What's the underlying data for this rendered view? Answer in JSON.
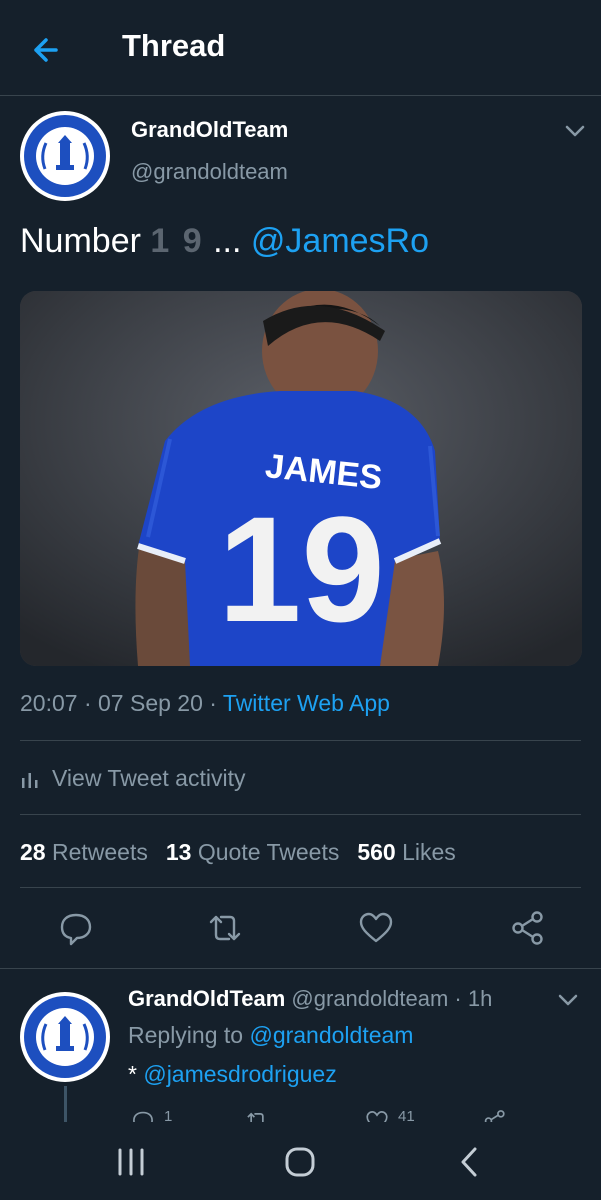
{
  "header": {
    "title": "Thread",
    "back_icon": "arrow-left-icon"
  },
  "tweet": {
    "author_name": "GrandOldTeam",
    "author_handle": "@grandoldteam",
    "avatar_ring_text": "It's a GrandOldTeam To Support",
    "avatar_badge": "GOT",
    "text_prefix": "Number",
    "text_numbers": "1  9",
    "text_ellipsis": " ... ",
    "text_mention": "@JamesRo",
    "image": {
      "jersey_name": "JAMES",
      "jersey_number": "19",
      "jersey_color": "#1d45c8"
    },
    "time": "20:07",
    "date": "07 Sep 20",
    "separator": " · ",
    "source": "Twitter Web App",
    "activity_label": "View Tweet activity",
    "stats": {
      "retweets_count": "28",
      "retweets_label": "Retweets",
      "quotes_count": "13",
      "quotes_label": "Quote Tweets",
      "likes_count": "560",
      "likes_label": "Likes"
    }
  },
  "reply": {
    "author_name": "GrandOldTeam",
    "author_handle": "@grandoldteam",
    "time_ago": "1h",
    "replying_prefix": "Replying to",
    "replying_handle": "@grandoldteam",
    "body_prefix": "*",
    "body_mention": "@jamesdrodriguez",
    "reply_count": "1",
    "like_count": "41"
  },
  "colors": {
    "background": "#15202b",
    "accent": "#1da1f2",
    "muted": "#8899a6",
    "divider": "#38444d"
  }
}
